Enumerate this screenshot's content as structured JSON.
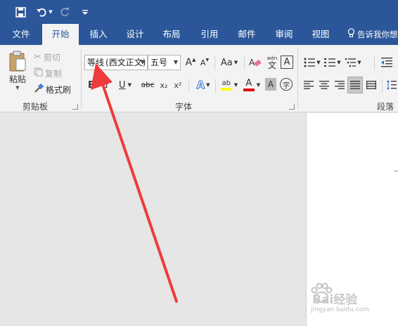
{
  "ribbon_tabs": [
    {
      "label": "文件"
    },
    {
      "label": "开始"
    },
    {
      "label": "插入"
    },
    {
      "label": "设计"
    },
    {
      "label": "布局"
    },
    {
      "label": "引用"
    },
    {
      "label": "邮件"
    },
    {
      "label": "审阅"
    },
    {
      "label": "视图"
    }
  ],
  "tell_me": "告诉我你想要做什么",
  "clipboard": {
    "paste_label": "粘贴",
    "cut_label": "剪切",
    "copy_label": "复制",
    "format_painter_label": "格式刷",
    "group_label": "剪贴板"
  },
  "font": {
    "font_name": "等线",
    "font_name_sub": "(西文正文)",
    "font_size": "五号",
    "group_label": "字体",
    "grow_label": "A",
    "shrink_label": "A",
    "change_case_label": "Aa",
    "phonetic_top": "wén",
    "phonetic_bottom": "文",
    "border_char_label": "A",
    "bold_label": "B",
    "italic_label": "I",
    "underline_label": "U",
    "strike_label": "abc",
    "subscript_label": "x₂",
    "superscript_label": "x²",
    "text_effect_label": "A",
    "highlight_label": "ab",
    "font_color_label": "A",
    "char_shade_label": "A",
    "enclose_label": "字"
  },
  "paragraph": {
    "group_label": "段落"
  },
  "watermark": {
    "brand": "Bai经验",
    "url": "jingyan.baidu.com"
  },
  "colors": {
    "titlebar": "#2b579a",
    "ribbon": "#f3f3f3",
    "arrow": "#ef3b3b",
    "highlight_yellow": "#ffff00",
    "font_red": "#e00000"
  }
}
